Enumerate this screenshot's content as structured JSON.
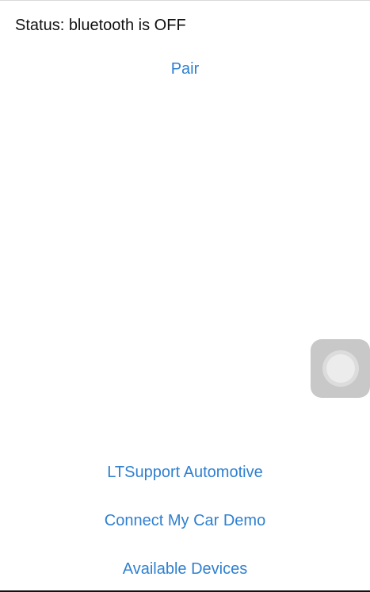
{
  "status": {
    "text": "Status: bluetooth is OFF"
  },
  "actions": {
    "pair": "Pair",
    "lt_support": "LTSupport Automotive",
    "connect_demo": "Connect My Car Demo",
    "available_devices": "Available Devices"
  },
  "colors": {
    "link": "#2f80d0",
    "text": "#111111",
    "background": "#ffffff"
  },
  "icons": {
    "assistive_touch": "assistive-touch-icon"
  }
}
